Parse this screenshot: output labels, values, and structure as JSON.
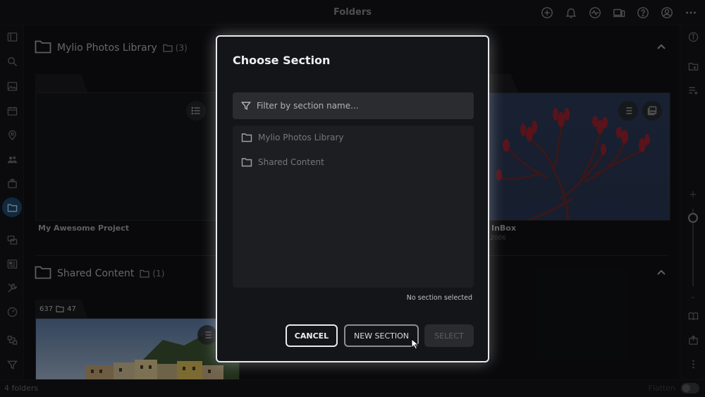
{
  "window": {
    "title": "Folders"
  },
  "top_icons": [
    "add-circle-icon",
    "bell-icon",
    "activity-icon",
    "devices-icon",
    "help-icon",
    "account-icon",
    "more-horizontal-icon"
  ],
  "sections": [
    {
      "title": "Mylio Photos Library",
      "count": "(3)"
    },
    {
      "title": "Shared Content",
      "count": "(1)"
    }
  ],
  "cards": {
    "project": {
      "name": "My Awesome Project"
    },
    "inbox": {
      "name": "InBox",
      "sub": "2006"
    },
    "shared": {
      "badge_photos": "637",
      "badge_folders": "47"
    }
  },
  "status": {
    "folder_count": "4 folders",
    "flatten_label": "Flatten"
  },
  "zoom": {
    "plus": "+",
    "minus": "-"
  },
  "modal": {
    "title": "Choose Section",
    "filter_placeholder": "Filter by section name...",
    "filter_value": "",
    "items": [
      "Mylio Photos Library",
      "Shared Content"
    ],
    "selection_status": "No section selected",
    "cancel_label": "CANCEL",
    "new_section_label": "NEW SECTION",
    "select_label": "SELECT"
  },
  "colors": {
    "accent": "#1f4c73",
    "modal_border": "#e9eaec",
    "background": "#111214"
  }
}
